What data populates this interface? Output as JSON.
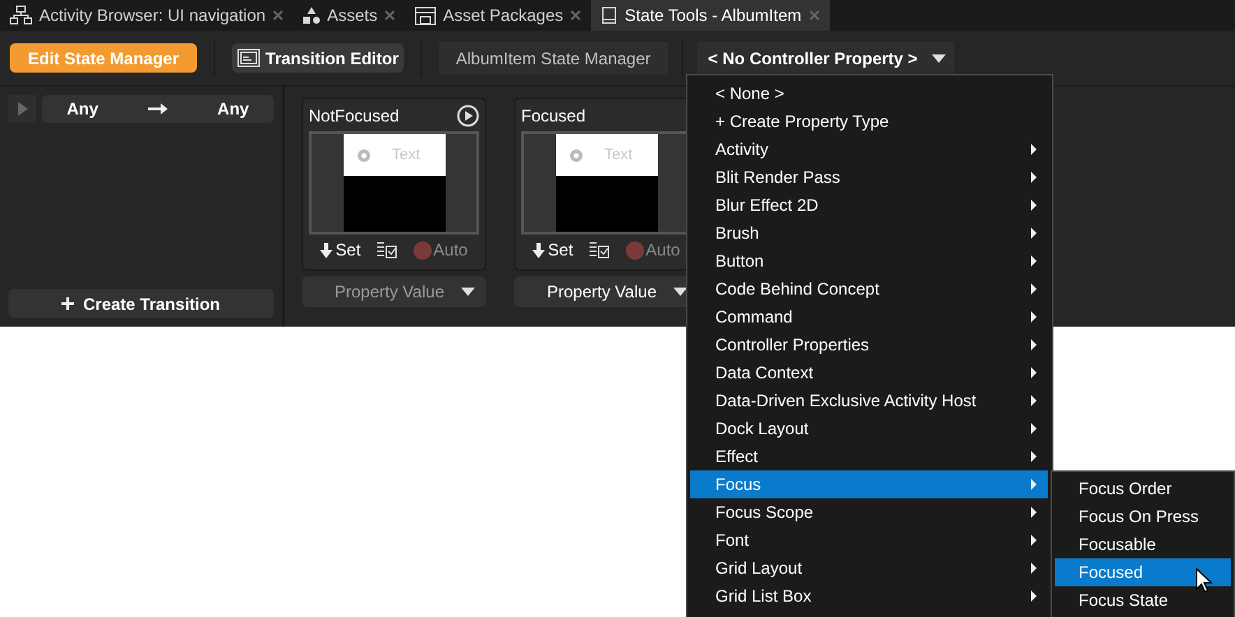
{
  "tabs": [
    {
      "label": "Activity Browser: UI navigation",
      "kind": "tree",
      "selected": false
    },
    {
      "label": "Assets",
      "kind": "shapes",
      "selected": false
    },
    {
      "label": "Asset Packages",
      "kind": "package",
      "selected": false
    },
    {
      "label": "State Tools - AlbumItem",
      "kind": "tablet",
      "selected": true
    }
  ],
  "toolbar": {
    "edit_button": "Edit State Manager",
    "transition_button": "Transition Editor",
    "state_manager_label": "AlbumItem State Manager",
    "controller_dropdown": "< No Controller Property >"
  },
  "transition_panel": {
    "from": "Any",
    "to": "Any",
    "create_button": "Create Transition"
  },
  "states": [
    {
      "name": "NotFocused",
      "preview_text": "Text",
      "set_button": "Set",
      "auto_label": "Auto",
      "property_dropdown": "Property Value",
      "playable": true,
      "dimmed": true
    },
    {
      "name": "Focused",
      "preview_text": "Text",
      "set_button": "Set",
      "auto_label": "Auto",
      "property_dropdown": "Property Value",
      "playable": false,
      "dimmed": false
    }
  ],
  "menu": {
    "items": [
      {
        "label": "< None >",
        "submenu": false,
        "selected": false
      },
      {
        "label": "+ Create Property Type",
        "submenu": false,
        "selected": false
      },
      {
        "label": "Activity",
        "submenu": true,
        "selected": false
      },
      {
        "label": "Blit Render Pass",
        "submenu": true,
        "selected": false
      },
      {
        "label": "Blur Effect 2D",
        "submenu": true,
        "selected": false
      },
      {
        "label": "Brush",
        "submenu": true,
        "selected": false
      },
      {
        "label": "Button",
        "submenu": true,
        "selected": false
      },
      {
        "label": "Code Behind Concept",
        "submenu": true,
        "selected": false
      },
      {
        "label": "Command",
        "submenu": true,
        "selected": false
      },
      {
        "label": "Controller Properties",
        "submenu": true,
        "selected": false
      },
      {
        "label": "Data Context",
        "submenu": true,
        "selected": false
      },
      {
        "label": "Data-Driven Exclusive Activity Host",
        "submenu": true,
        "selected": false
      },
      {
        "label": "Dock Layout",
        "submenu": true,
        "selected": false
      },
      {
        "label": "Effect",
        "submenu": true,
        "selected": false
      },
      {
        "label": "Focus",
        "submenu": true,
        "selected": true
      },
      {
        "label": "Focus Scope",
        "submenu": true,
        "selected": false
      },
      {
        "label": "Font",
        "submenu": true,
        "selected": false
      },
      {
        "label": "Grid Layout",
        "submenu": true,
        "selected": false
      },
      {
        "label": "Grid List Box",
        "submenu": true,
        "selected": false
      }
    ],
    "submenu": [
      {
        "label": "Focus Order",
        "selected": false
      },
      {
        "label": "Focus On Press",
        "selected": false
      },
      {
        "label": "Focusable",
        "selected": false
      },
      {
        "label": "Focused",
        "selected": true
      },
      {
        "label": "Focus State",
        "selected": false
      }
    ]
  }
}
